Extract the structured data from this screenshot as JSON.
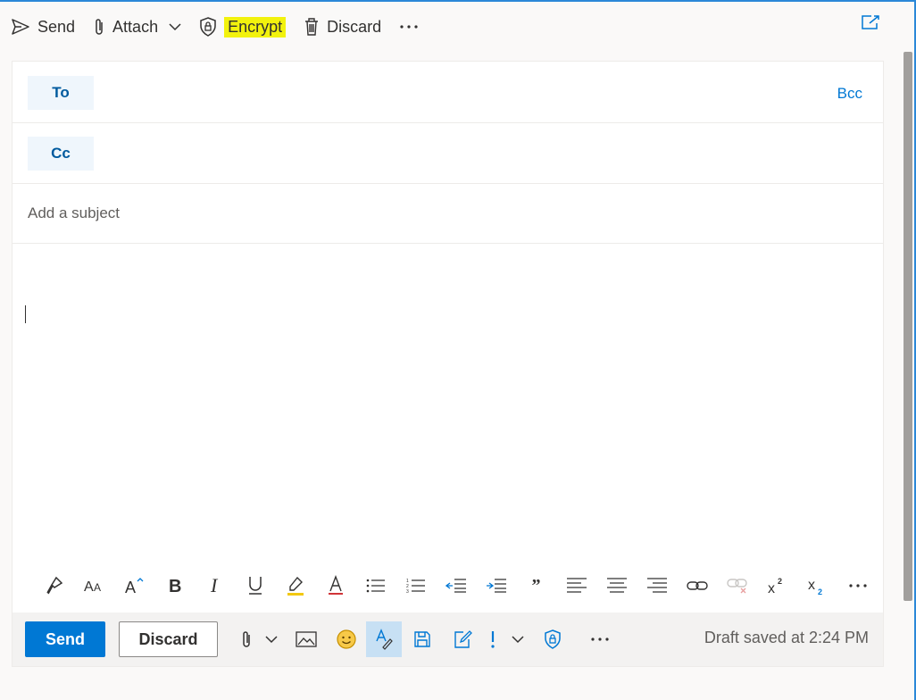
{
  "toolbar": {
    "send_label": "Send",
    "attach_label": "Attach",
    "encrypt_label": "Encrypt",
    "discard_label": "Discard"
  },
  "fields": {
    "to_label": "To",
    "cc_label": "Cc",
    "bcc_label": "Bcc",
    "subject_placeholder": "Add a subject"
  },
  "format_bar": {
    "icons": [
      "format-painter-icon",
      "font-size-icon",
      "grow-font-icon",
      "bold-icon",
      "italic-icon",
      "underline-icon",
      "highlight-icon",
      "font-color-icon",
      "bullets-icon",
      "numbering-icon",
      "decrease-indent-icon",
      "increase-indent-icon",
      "quote-icon",
      "align-left-icon",
      "align-center-icon",
      "align-right-icon",
      "insert-link-icon",
      "remove-link-icon",
      "superscript-icon",
      "subscript-icon",
      "more-options-icon"
    ]
  },
  "bottom_bar": {
    "send_label": "Send",
    "discard_label": "Discard",
    "draft_status": "Draft saved at 2:24 PM"
  },
  "colors": {
    "accent": "#0078d4",
    "highlight": "#f2f20d",
    "field_button_bg": "#eff6fc"
  }
}
